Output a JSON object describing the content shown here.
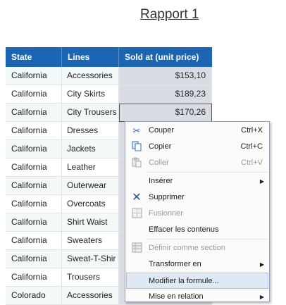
{
  "report": {
    "title": "Rapport 1"
  },
  "table": {
    "columns": [
      "State",
      "Lines",
      "Sold at (unit price)"
    ],
    "rows": [
      {
        "state": "California",
        "line": "Accessories",
        "price": "$153,10"
      },
      {
        "state": "California",
        "line": "City Skirts",
        "price": "$189,23"
      },
      {
        "state": "California",
        "line": "City Trousers",
        "price": "$170,26"
      },
      {
        "state": "California",
        "line": "Dresses",
        "price": ""
      },
      {
        "state": "California",
        "line": "Jackets",
        "price": ""
      },
      {
        "state": "California",
        "line": "Leather",
        "price": ""
      },
      {
        "state": "California",
        "line": "Outerwear",
        "price": ""
      },
      {
        "state": "California",
        "line": "Overcoats",
        "price": ""
      },
      {
        "state": "California",
        "line": "Shirt Waist",
        "price": ""
      },
      {
        "state": "California",
        "line": "Sweaters",
        "price": ""
      },
      {
        "state": "California",
        "line": "Sweat-T-Shir",
        "price": ""
      },
      {
        "state": "California",
        "line": "Trousers",
        "price": ""
      },
      {
        "state": "Colorado",
        "line": "Accessories",
        "price": ""
      }
    ]
  },
  "context_menu": {
    "items": [
      {
        "label": "Couper",
        "shortcut": "Ctrl+X",
        "icon": "scissors-icon"
      },
      {
        "label": "Copier",
        "shortcut": "Ctrl+C",
        "icon": "copy-icon"
      },
      {
        "label": "Coller",
        "shortcut": "Ctrl+V",
        "icon": "paste-icon",
        "disabled": true
      },
      {
        "label": "Insérer",
        "submenu": true
      },
      {
        "label": "Supprimer",
        "icon": "delete-icon"
      },
      {
        "label": "Fusionner",
        "icon": "merge-icon",
        "disabled": true
      },
      {
        "label": "Effacer les contenus"
      },
      {
        "label": "Définir comme section",
        "icon": "section-icon",
        "disabled": true
      },
      {
        "label": "Transformer en",
        "submenu": true
      },
      {
        "label": "Modifier la formule...",
        "highlighted": true
      },
      {
        "label": "Mise en relation",
        "submenu": true
      }
    ]
  },
  "colors": {
    "header_bg": "#1b65b3",
    "row_alt": "#f3f8f8",
    "highlight": "#dfe9f5"
  }
}
